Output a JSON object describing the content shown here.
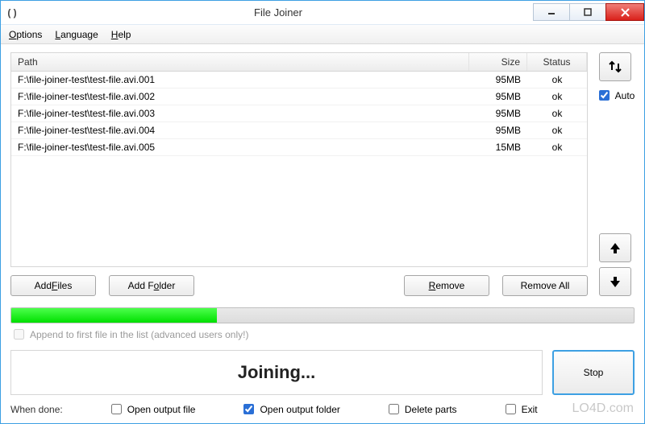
{
  "title": "File Joiner",
  "menu": {
    "options": "Options",
    "language": "Language",
    "help": "Help"
  },
  "columns": {
    "path": "Path",
    "size": "Size",
    "status": "Status"
  },
  "files": [
    {
      "path": "F:\\file-joiner-test\\test-file.avi.001",
      "size": "95MB",
      "status": "ok"
    },
    {
      "path": "F:\\file-joiner-test\\test-file.avi.002",
      "size": "95MB",
      "status": "ok"
    },
    {
      "path": "F:\\file-joiner-test\\test-file.avi.003",
      "size": "95MB",
      "status": "ok"
    },
    {
      "path": "F:\\file-joiner-test\\test-file.avi.004",
      "size": "95MB",
      "status": "ok"
    },
    {
      "path": "F:\\file-joiner-test\\test-file.avi.005",
      "size": "15MB",
      "status": "ok"
    }
  ],
  "buttons": {
    "add_files": "Add Files",
    "add_folder": "Add Folder",
    "remove": "Remove",
    "remove_all": "Remove All",
    "stop": "Stop"
  },
  "side": {
    "auto_label": "Auto",
    "auto_checked": true
  },
  "progress": {
    "percent": 33
  },
  "append": {
    "label": "Append to first file in the list (advanced users only!)",
    "checked": false,
    "enabled": false
  },
  "status_text": "Joining...",
  "when_done": {
    "label": "When done:",
    "open_file": {
      "label": "Open output file",
      "checked": false
    },
    "open_folder": {
      "label": "Open output folder",
      "checked": true
    },
    "delete_parts": {
      "label": "Delete parts",
      "checked": false
    },
    "exit": {
      "label": "Exit",
      "checked": false
    }
  },
  "watermark": "LO4D.com"
}
